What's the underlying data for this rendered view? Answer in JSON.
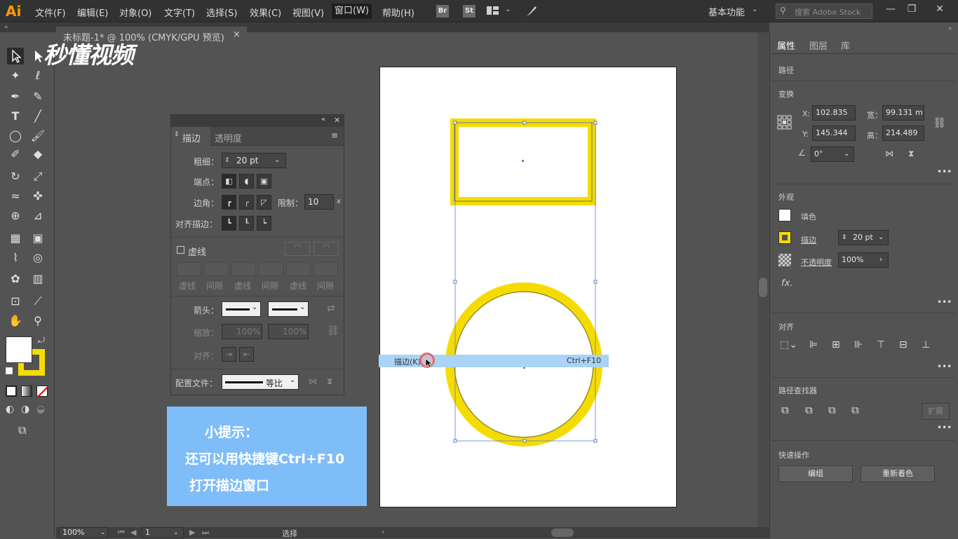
{
  "menubar": {
    "logo": "Ai",
    "items": [
      "文件(F)",
      "编辑(E)",
      "对象(O)",
      "文字(T)",
      "选择(S)",
      "效果(C)",
      "视图(V)",
      "窗口(W)",
      "帮助(H)"
    ],
    "bridge_labels": [
      "Br",
      "St"
    ],
    "workspace": "基本功能",
    "search_placeholder": "搜索 Adobe Stock"
  },
  "document_tab": {
    "title": "未标题-1* @ 100% (CMYK/GPU 预览)",
    "close": "×"
  },
  "watermark": "秒懂视频",
  "stroke_panel": {
    "tabs": [
      "描边",
      "透明度"
    ],
    "weight_label": "粗细：",
    "weight_value": "20 pt",
    "cap_label": "端点：",
    "corner_label": "边角：",
    "limit_label": "限制：",
    "limit_value": "10",
    "limit_unit": "x",
    "align_label": "对齐描边：",
    "dashed_label": "虚线",
    "dash_labels": [
      "虚线",
      "间隙",
      "虚线",
      "间隙",
      "虚线",
      "间隙"
    ],
    "arrow_label": "箭头：",
    "scale_label": "缩放：",
    "scale_values": [
      "100%",
      "100%"
    ],
    "align2_label": "对齐：",
    "profile_label": "配置文件：",
    "profile_value": "等比"
  },
  "tip": {
    "title": "小提示：",
    "line1": "还可以用快捷键Ctrl+F10",
    "line2": "打开描边窗口"
  },
  "menu_highlight": {
    "label": "描边(K)",
    "shortcut": "Ctrl+F10"
  },
  "right_panel": {
    "tabs": [
      "属性",
      "图层",
      "库"
    ],
    "path_label": "路径",
    "transform_label": "变换",
    "x_label": "X:",
    "x_value": "102.835",
    "y_label": "Y:",
    "y_value": "145.344",
    "w_label": "宽：",
    "w_value": "99.131 m",
    "h_label": "高：",
    "h_value": "214.489",
    "angle_value": "0°",
    "appearance_label": "外观",
    "fill_label": "填色",
    "stroke_label": "描边",
    "stroke_value": "20 pt",
    "opacity_label": "不透明度",
    "opacity_value": "100%",
    "fx_label": "fx.",
    "align_label": "对齐",
    "pathfinder_label": "路径查找器",
    "expand_label": "扩展",
    "quick_label": "快速操作",
    "group_button": "编组",
    "recolor_button": "重新着色"
  },
  "statusbar": {
    "zoom": "100%",
    "page": "1",
    "tool": "选择"
  },
  "colors": {
    "accent": "#f5dc00",
    "tip_bg": "#7fbdf8",
    "highlight": "#a9d3f7"
  }
}
